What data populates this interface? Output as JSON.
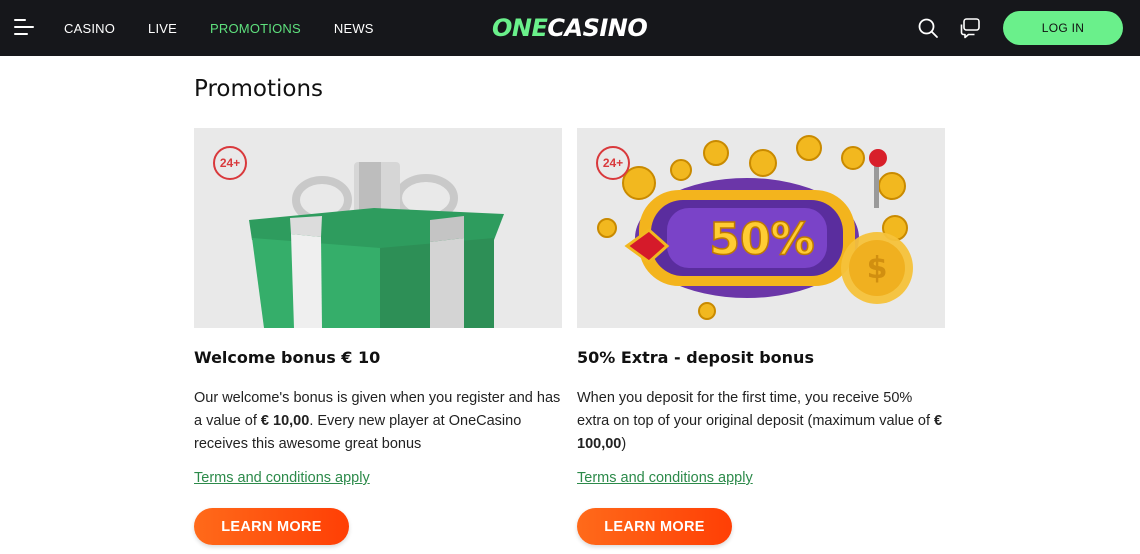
{
  "header": {
    "nav": [
      {
        "label": "CASINO",
        "active": false
      },
      {
        "label": "LIVE",
        "active": false
      },
      {
        "label": "PROMOTIONS",
        "active": true
      },
      {
        "label": "NEWS",
        "active": false
      }
    ],
    "logo_one": "ONE",
    "logo_casino": "CASINO",
    "login_label": "LOG IN",
    "colors": {
      "background": "#16171b",
      "accent": "#6af08b"
    }
  },
  "page": {
    "title": "Promotions"
  },
  "promotions": [
    {
      "age_badge": "24+",
      "title": "Welcome bonus € 10",
      "desc_part1": "Our welcome's bonus is given when you register and has a value of ",
      "desc_bold1": "€ 10,00",
      "desc_part2": ". Every new player at OneCasino receives this awesome great bonus",
      "terms": "Terms and conditions apply",
      "button": "LEARN MORE",
      "image_icon": "gift-box"
    },
    {
      "age_badge": "24+",
      "title": "50% Extra - deposit bonus",
      "desc_part1": "When you deposit for the first time, you receive 50% extra on top of your original deposit (maximum value of ",
      "desc_bold1": "€ 100,00",
      "desc_part2": ")",
      "terms": "Terms and conditions apply",
      "button": "LEARN MORE",
      "image_icon": "slot-machine-coins",
      "image_text": "50%"
    }
  ]
}
